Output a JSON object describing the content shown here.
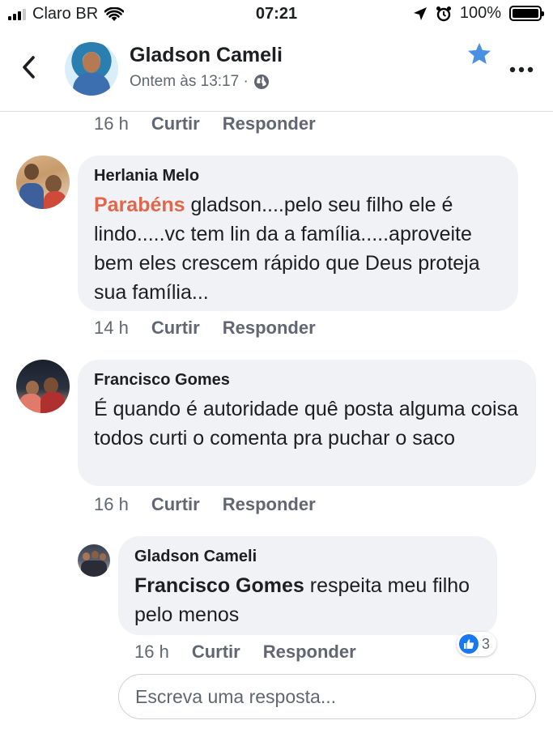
{
  "status_bar": {
    "carrier": "Claro BR",
    "time": "07:21",
    "battery": "100%",
    "signal_bars_filled": 3,
    "signal_bars_total": 4
  },
  "header": {
    "name": "Gladson Cameli",
    "subtitle": "Ontem às 13:17 ·",
    "back_icon": "chevron-left-icon",
    "star_icon": "star-icon",
    "more_icon": "more-icon",
    "accent_color": "#4a90e2"
  },
  "top_meta": {
    "time": "16 h",
    "like": "Curtir",
    "reply": "Responder"
  },
  "comments": [
    {
      "author": "Herlania Melo",
      "highlight": "Parabéns",
      "text": " gladson....pelo seu filho ele é lindo.....vc tem lin da a família.....aproveite bem eles crescem rápido  que Deus proteja sua família...",
      "time": "14 h",
      "like": "Curtir",
      "reply": "Responder"
    },
    {
      "author": "Francisco Gomes",
      "text": "É quando é autoridade quê posta alguma coisa todos curti o comenta pra puchar o saco",
      "time": "16 h",
      "like": "Curtir",
      "reply": "Responder"
    }
  ],
  "reply": {
    "author": "Gladson Cameli",
    "mention": "Francisco Gomes",
    "text": "  respeita meu filho pelo menos",
    "time": "16 h",
    "like": "Curtir",
    "reply": "Responder",
    "reaction_count": "3",
    "reaction_icon": "like-icon"
  },
  "reply_input": {
    "placeholder": "Escreva uma resposta...",
    "value": ""
  }
}
